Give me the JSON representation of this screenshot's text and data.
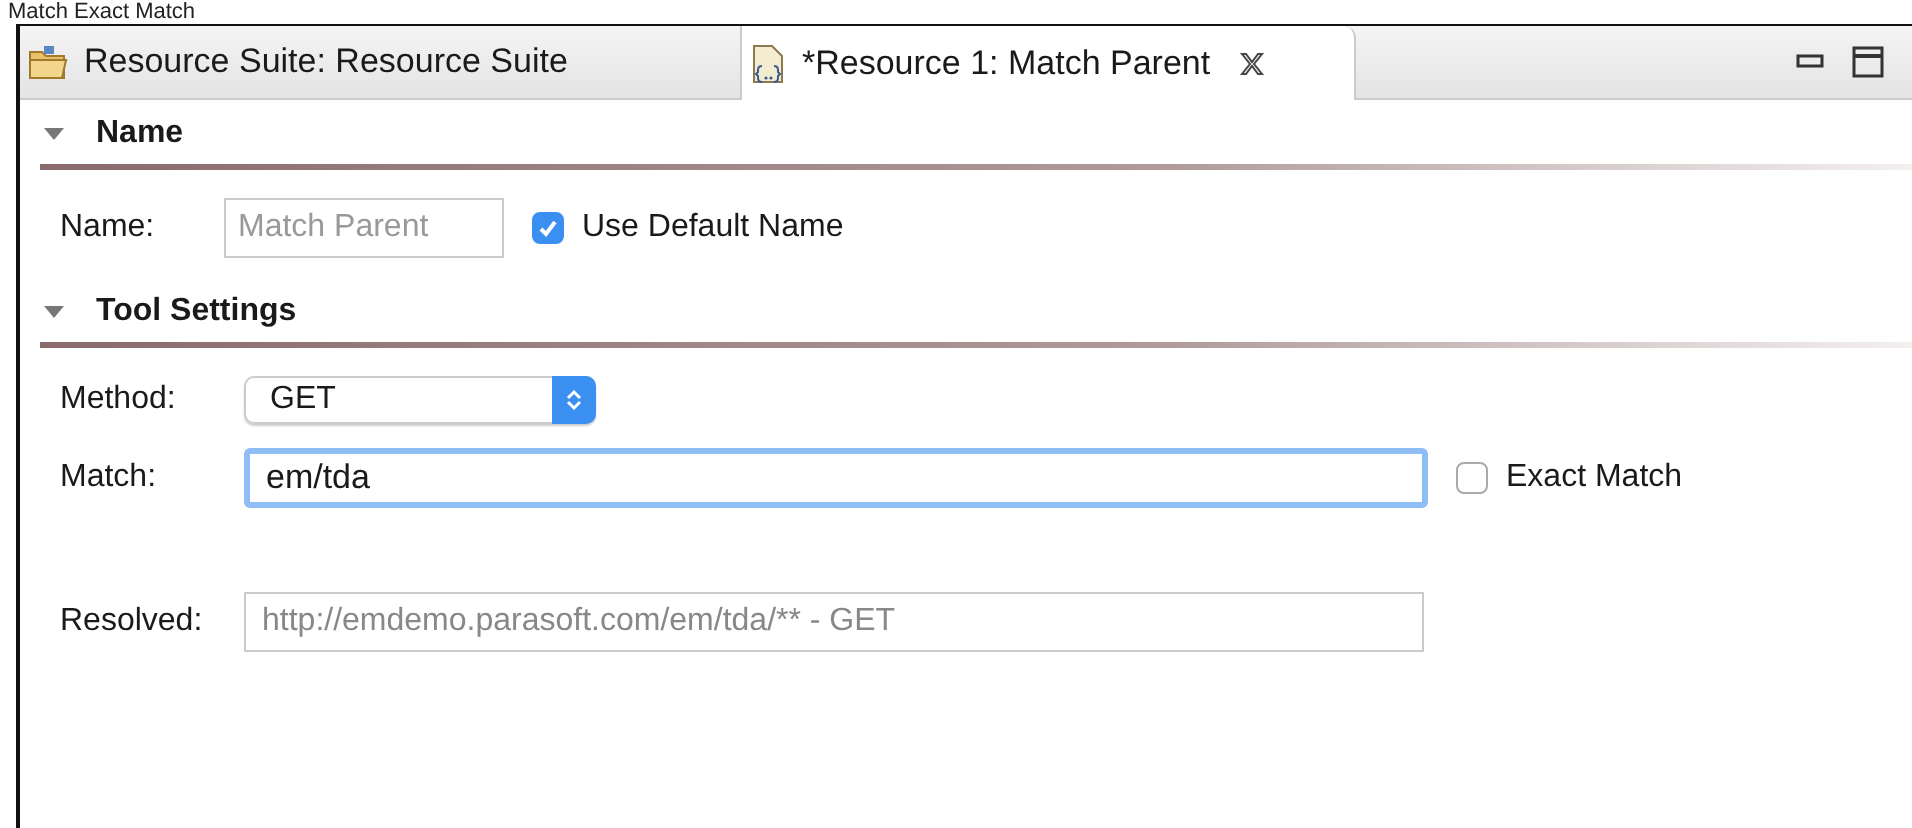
{
  "caption": "Match Exact Match",
  "tabs": [
    {
      "label": "Resource Suite: Resource Suite",
      "kind": "suite",
      "selected": false,
      "closable": false
    },
    {
      "label": "*Resource 1: Match Parent",
      "kind": "resource",
      "selected": true,
      "closable": true
    }
  ],
  "sections": [
    {
      "title": "Name",
      "expanded": true,
      "kind": "name",
      "name_label": "Name:",
      "name_value": "Match Parent",
      "checkbox": {
        "label": "Use Default Name",
        "checked": true
      }
    },
    {
      "title": "Tool Settings",
      "expanded": true,
      "kind": "tool",
      "method_label": "Method:",
      "method_value": "GET",
      "match_label": "Match:",
      "match_value": "em/tda",
      "match_focused": true,
      "checkbox": {
        "label": "Exact Match",
        "checked": false
      },
      "resolved_label": "Resolved:",
      "resolved_value": "http://emdemo.parasoft.com/em/tda/** - GET"
    }
  ]
}
